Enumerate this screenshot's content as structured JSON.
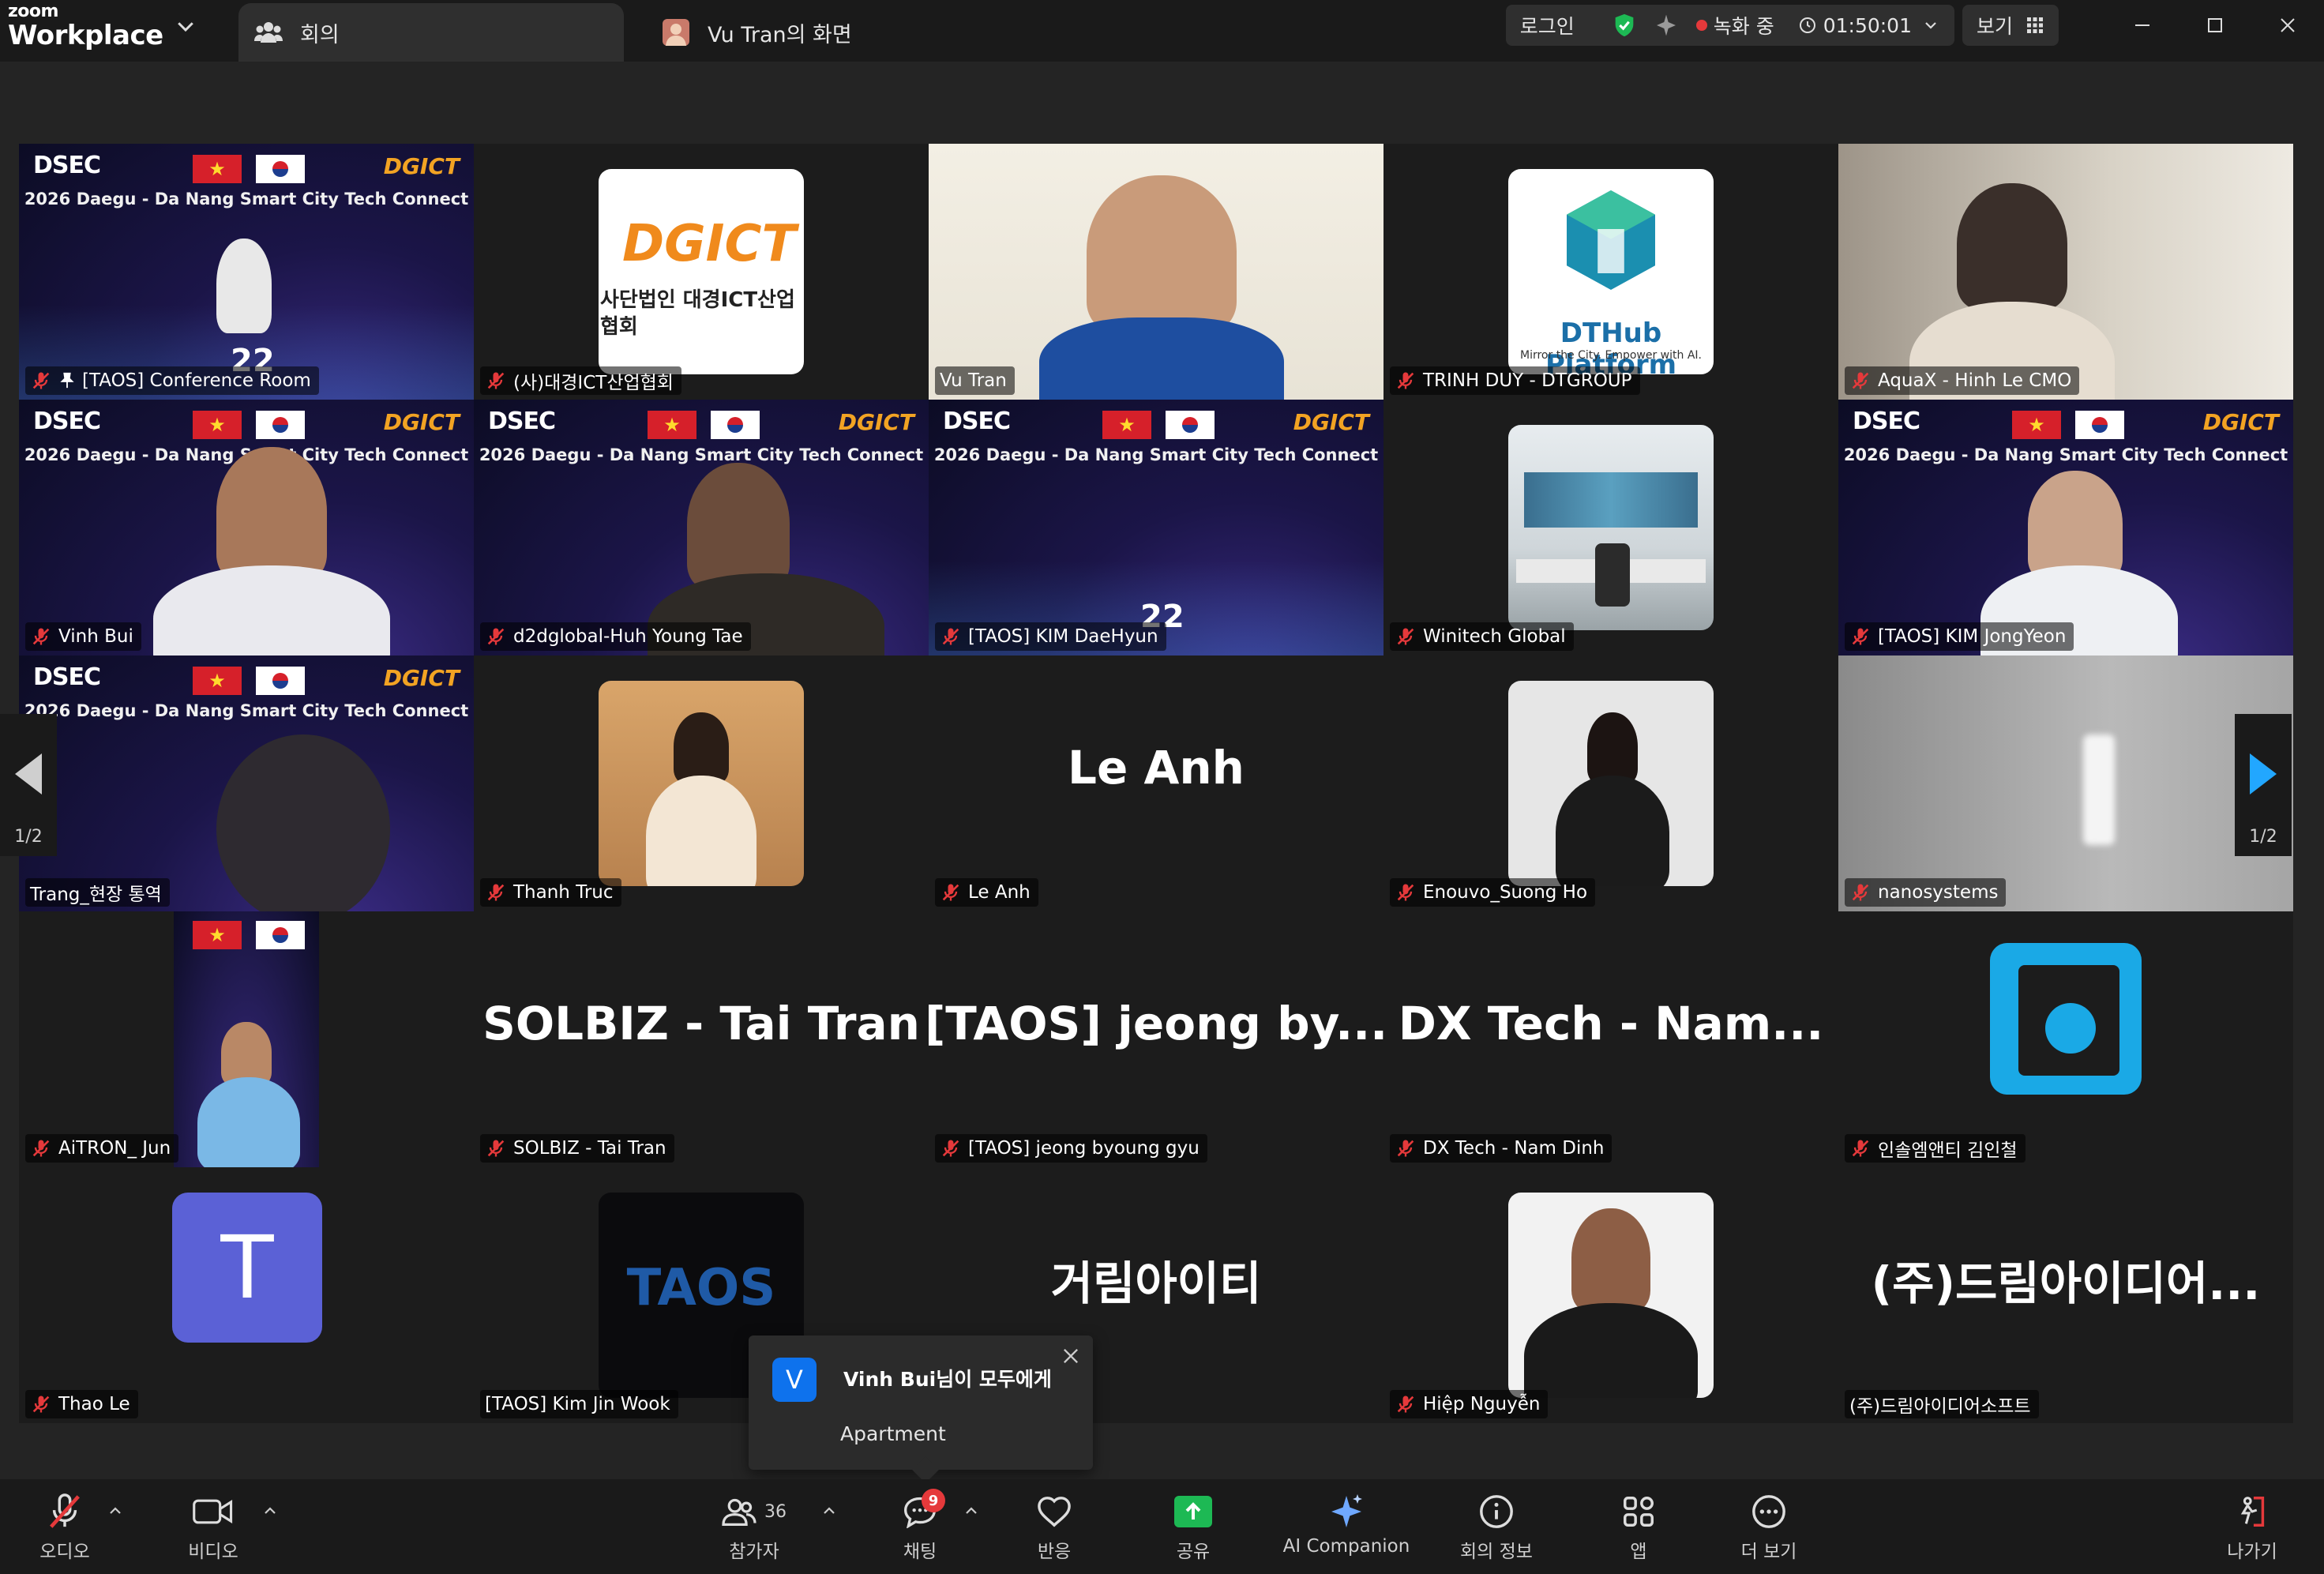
{
  "app": {
    "brand_small": "zoom",
    "brand_big": "Workplace"
  },
  "tabs": {
    "meeting": "회의",
    "share": "Vu Tran의 화면"
  },
  "header": {
    "login": "로그인",
    "recording": "녹화 중",
    "timer": "01:50:01",
    "view": "보기"
  },
  "banner": {
    "title": "2026 Daegu - Da Nang Smart City Tech Connect",
    "logo_left": "DSEC",
    "logo_right": "DGICT"
  },
  "tiles": [
    {
      "name": "[TAOS] Conference Room",
      "pinned": true,
      "type": "banner"
    },
    {
      "name": "(사)대경ICT산업협회",
      "type": "card",
      "card_text": "DGICT",
      "card_sub": "사단법인 대경ICT산업협회"
    },
    {
      "name": "Vu Tran",
      "type": "video"
    },
    {
      "name": "TRINH DUY - DTGROUP",
      "type": "card",
      "card_text": "DTHub Platform",
      "card_sub": "Mirror the City. Empower with AI."
    },
    {
      "name": "AquaX - Hinh Le CMO",
      "type": "video"
    },
    {
      "name": "Vinh Bui",
      "type": "banner"
    },
    {
      "name": "d2dglobal-Huh Young Tae",
      "type": "banner"
    },
    {
      "name": "[TAOS] KIM DaeHyun",
      "type": "banner"
    },
    {
      "name": "Winitech Global",
      "type": "card"
    },
    {
      "name": "[TAOS] KIM JongYeon",
      "type": "banner"
    },
    {
      "name": "Trang_현장 통역",
      "type": "banner",
      "active": true
    },
    {
      "name": "Thanh Truc",
      "type": "card"
    },
    {
      "name": "Le Anh",
      "type": "text",
      "big": "Le Anh"
    },
    {
      "name": "Enouvo_Suong Ho",
      "type": "card"
    },
    {
      "name": "nanosystems",
      "type": "video"
    },
    {
      "name": "AiTRON_ Jun",
      "type": "banner"
    },
    {
      "name": "SOLBIZ - Tai Tran",
      "type": "text",
      "big": "SOLBIZ - Tai Tran"
    },
    {
      "name": "[TAOS] jeong byoung gyu",
      "type": "text",
      "big": "[TAOS] jeong by..."
    },
    {
      "name": "DX Tech - Nam Dinh",
      "type": "text",
      "big": "DX Tech - Nam..."
    },
    {
      "name": "인솔엠앤티 김인철",
      "type": "card"
    },
    {
      "name": "Thao Le",
      "type": "card",
      "card_text": "T"
    },
    {
      "name": "[TAOS] Kim Jin Wook",
      "type": "card",
      "card_text": "TAOS"
    },
    {
      "name": "거림아이티",
      "type": "text",
      "big": "거림아이티"
    },
    {
      "name": "Hiệp Nguyễn",
      "type": "card"
    },
    {
      "name": "(주)드림아이디어소프트",
      "type": "text",
      "big": "(주)드림아이디어..."
    }
  ],
  "banner_date": "22",
  "pager": {
    "left": "1/2",
    "right": "1/2"
  },
  "toast": {
    "avatar": "V",
    "from": "Vinh Bui님이 모두에게",
    "message": "Apartment"
  },
  "toolbar": {
    "audio": "오디오",
    "video": "비디오",
    "participants": "참가자",
    "participants_count": "36",
    "chat": "채팅",
    "chat_badge": "9",
    "reactions": "반응",
    "share": "공유",
    "ai": "AI Companion",
    "info": "회의 정보",
    "apps": "앱",
    "more": "더 보기",
    "leave": "나가기"
  },
  "colors": {
    "accent_green": "#23d98f",
    "zoom_blue": "#0e72ed",
    "record_red": "#e5393b",
    "share_green": "#1db954"
  }
}
